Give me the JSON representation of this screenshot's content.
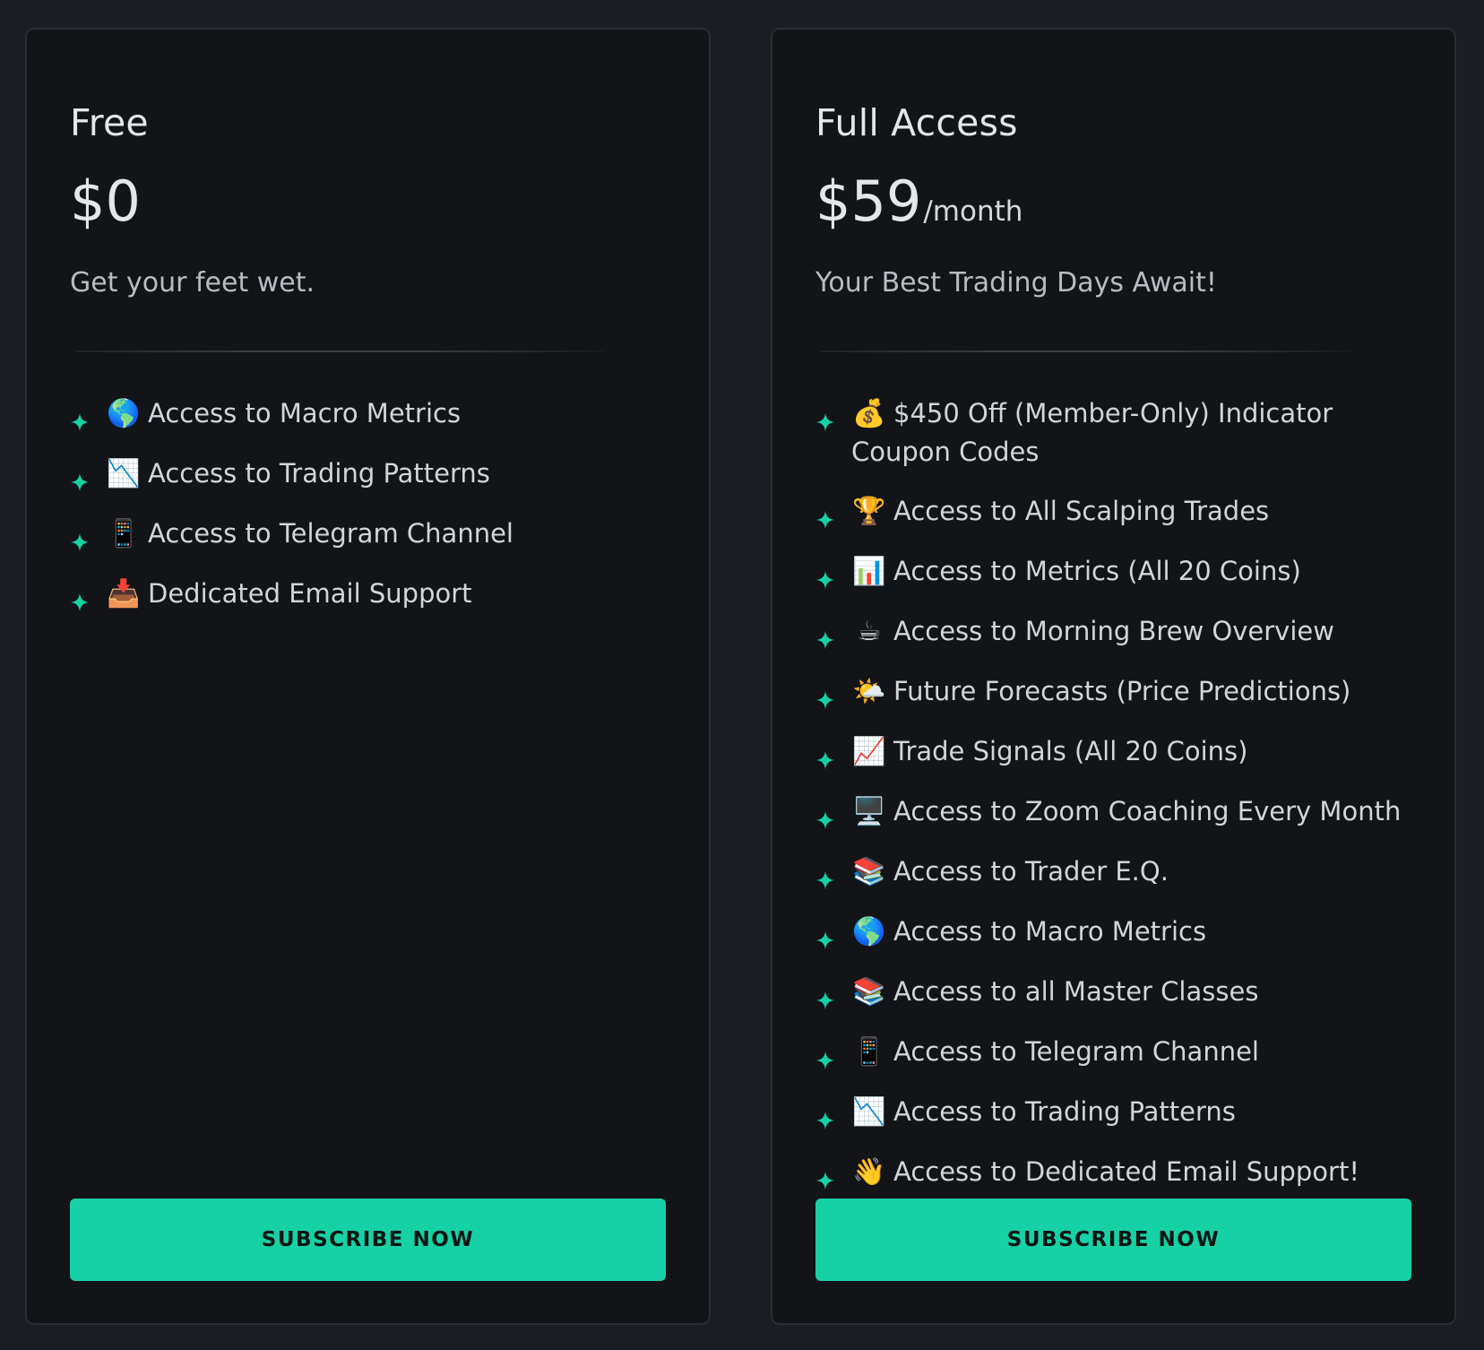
{
  "plans": [
    {
      "name": "Free",
      "price": "$0",
      "period": "",
      "tagline": "Get your feet wet.",
      "features": [
        {
          "icon": "🌎",
          "text": "Access to Macro Metrics"
        },
        {
          "icon": "📉",
          "text": "Access to Trading Patterns"
        },
        {
          "icon": "📱",
          "text": "Access to Telegram Channel"
        },
        {
          "icon": "📥",
          "text": "Dedicated Email Support"
        }
      ],
      "button_label": "SUBSCRIBE NOW"
    },
    {
      "name": "Full Access",
      "price": "$59",
      "period": "/month",
      "tagline": "Your Best Trading Days Await!",
      "features": [
        {
          "icon": "💰",
          "text": "$450 Off (Member-Only) Indicator Coupon Codes"
        },
        {
          "icon": "🏆",
          "text": "Access to All Scalping Trades"
        },
        {
          "icon": "📊",
          "text": "Access to Metrics (All 20 Coins)"
        },
        {
          "icon": "☕",
          "text": "Access to Morning Brew Overview"
        },
        {
          "icon": "🌤️",
          "text": "Future Forecasts (Price Predictions)"
        },
        {
          "icon": "📈",
          "text": "Trade Signals (All 20 Coins)"
        },
        {
          "icon": "🖥️",
          "text": "Access to Zoom Coaching Every Month"
        },
        {
          "icon": "📚",
          "text": "Access to Trader E.Q."
        },
        {
          "icon": "🌎",
          "text": "Access to Macro Metrics"
        },
        {
          "icon": "📚",
          "text": "Access to all Master Classes"
        },
        {
          "icon": "📱",
          "text": "Access to Telegram Channel"
        },
        {
          "icon": "📉",
          "text": "Access to Trading Patterns"
        },
        {
          "icon": "👋",
          "text": "Access to Dedicated Email Support!"
        }
      ],
      "button_label": "SUBSCRIBE NOW"
    }
  ],
  "colors": {
    "accent": "#16d1a6",
    "background": "#1a1d24",
    "card": "#121418"
  }
}
